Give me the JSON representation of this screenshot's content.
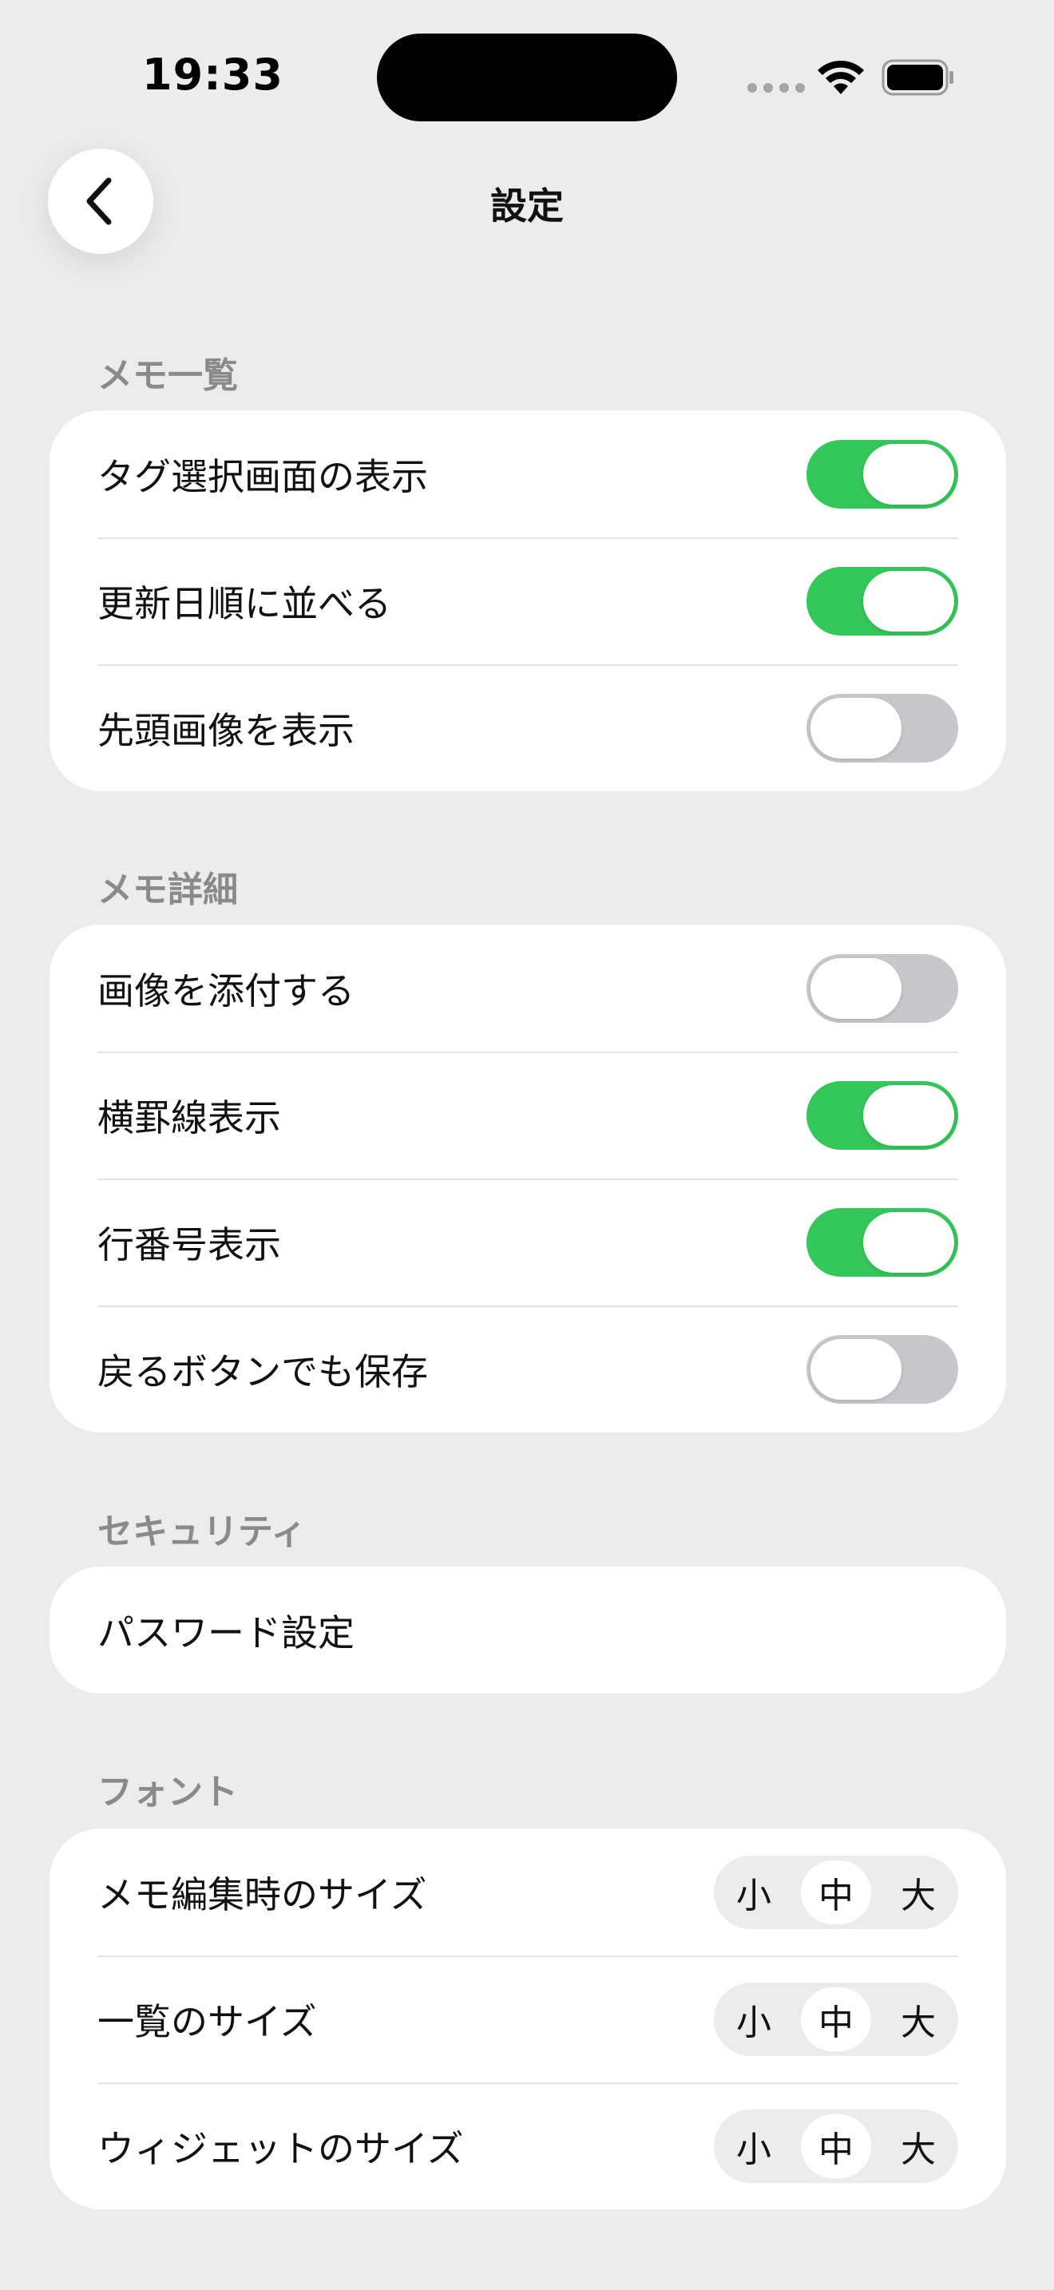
{
  "status_bar": {
    "time": "19:33"
  },
  "header": {
    "title": "設定",
    "back_icon": "chevron-left-icon"
  },
  "sections": {
    "memo_list": {
      "title": "メモ一覧",
      "items": [
        {
          "label": "タグ選択画面の表示",
          "on": true
        },
        {
          "label": "更新日順に並べる",
          "on": true
        },
        {
          "label": "先頭画像を表示",
          "on": false
        }
      ]
    },
    "memo_detail": {
      "title": "メモ詳細",
      "items": [
        {
          "label": "画像を添付する",
          "on": false
        },
        {
          "label": "横罫線表示",
          "on": true
        },
        {
          "label": "行番号表示",
          "on": true
        },
        {
          "label": "戻るボタンでも保存",
          "on": false
        }
      ]
    },
    "security": {
      "title": "セキュリティ",
      "items": [
        {
          "label": "パスワード設定"
        }
      ]
    },
    "font": {
      "title": "フォント",
      "size_options": [
        "小",
        "中",
        "大"
      ],
      "items": [
        {
          "label": "メモ編集時のサイズ",
          "selected": "中"
        },
        {
          "label": "一覧のサイズ",
          "selected": "中"
        },
        {
          "label": "ウィジェットのサイズ",
          "selected": "中"
        }
      ]
    }
  },
  "colors": {
    "toggle_on": "#34c759",
    "toggle_off": "#c8c8cc",
    "background": "#ececec"
  }
}
